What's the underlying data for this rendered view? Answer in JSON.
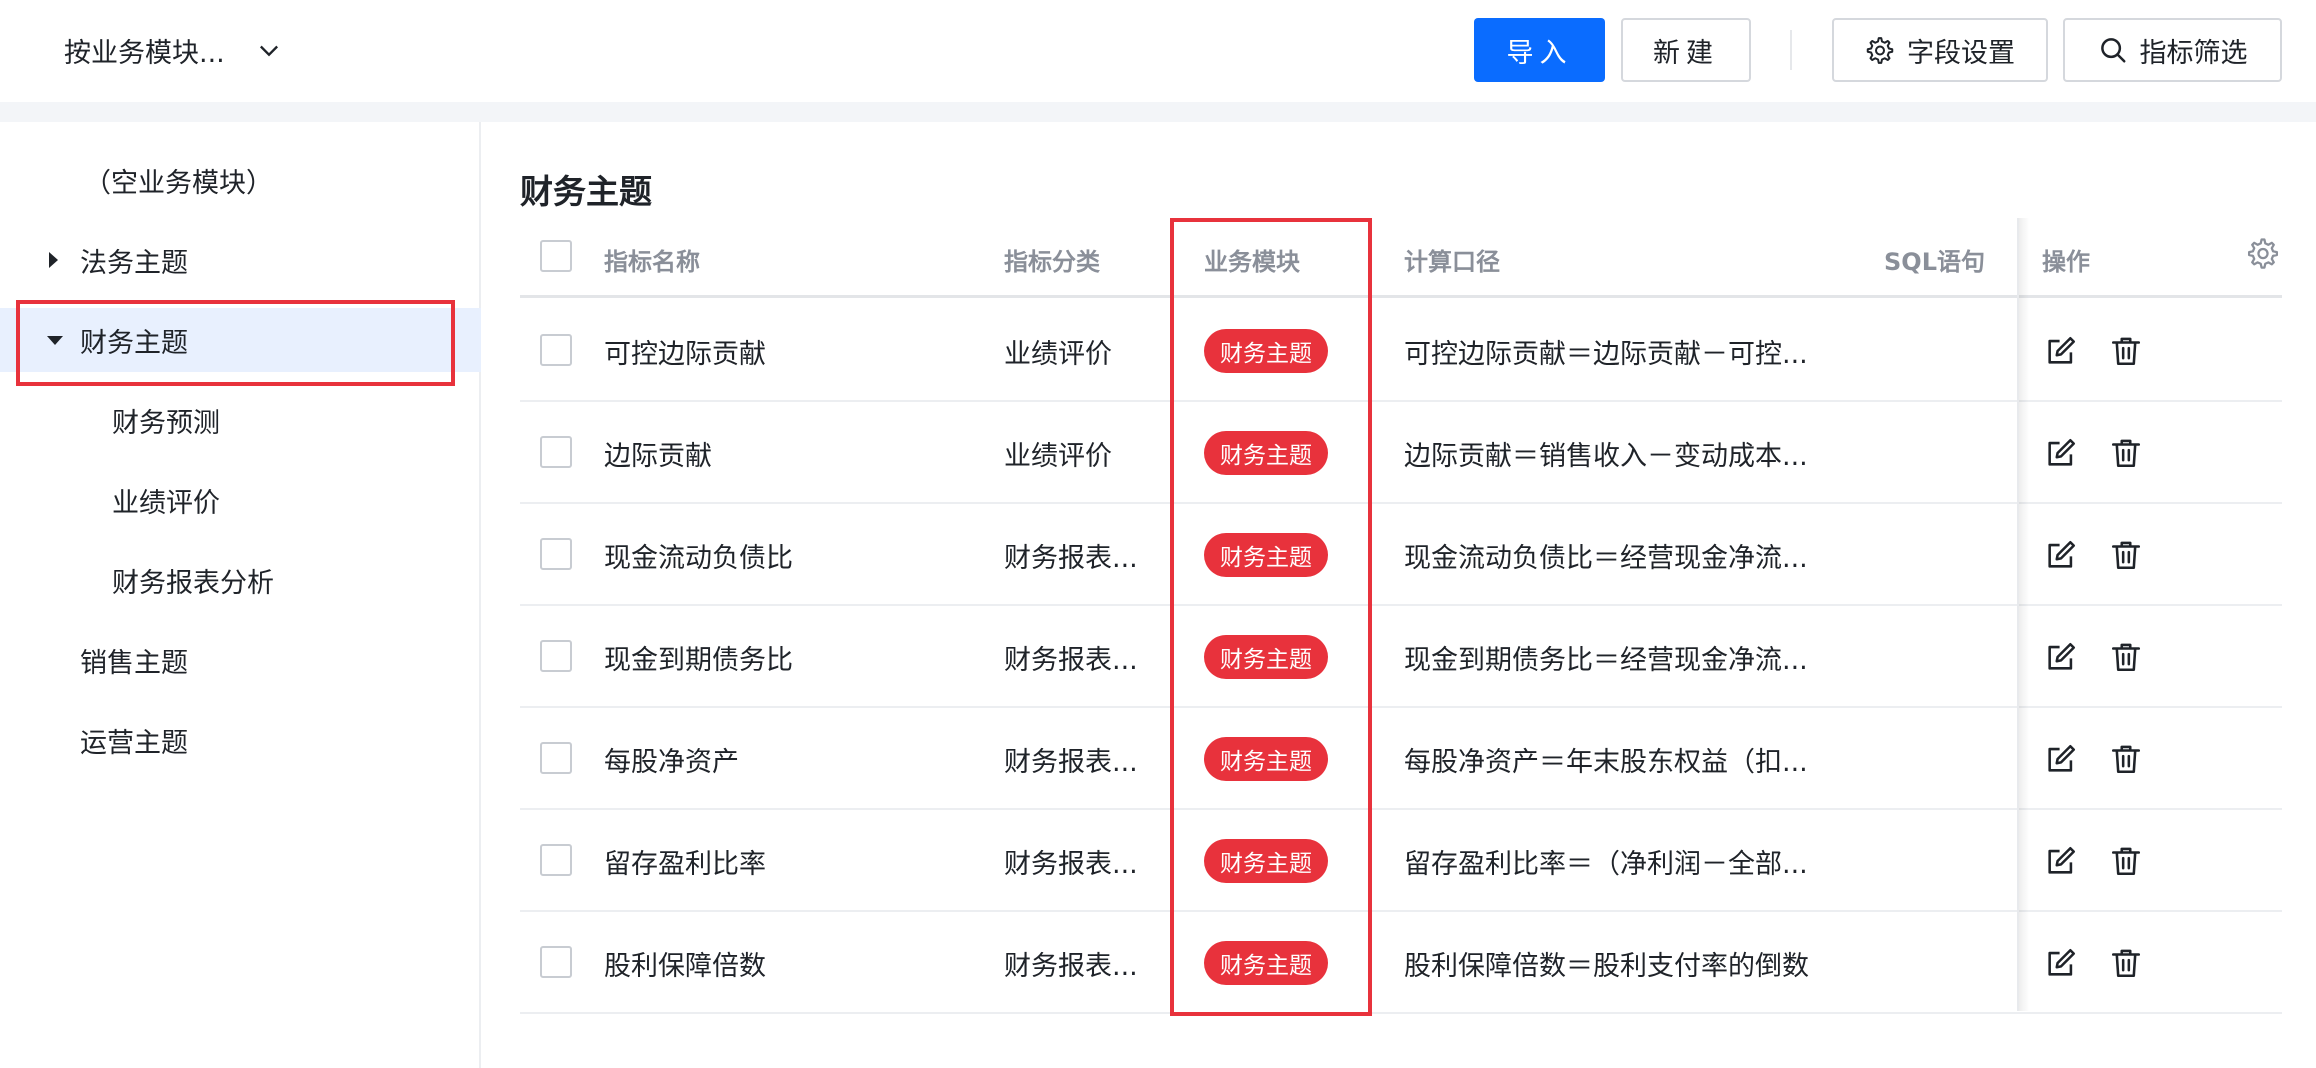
{
  "header": {
    "module_select": "按业务模块...",
    "import_label": "导入",
    "new_label": "新建",
    "field_settings_label": "字段设置",
    "filter_label": "指标筛选"
  },
  "sidebar": {
    "items": [
      {
        "label": "（空业务模块）"
      },
      {
        "label": "法务主题"
      },
      {
        "label": "财务主题"
      },
      {
        "label": "财务预测"
      },
      {
        "label": "业绩评价"
      },
      {
        "label": "财务报表分析"
      },
      {
        "label": "销售主题"
      },
      {
        "label": "运营主题"
      }
    ]
  },
  "main": {
    "title": "财务主题",
    "columns": [
      "指标名称",
      "指标分类",
      "业务模块",
      "计算口径",
      "SQL语句",
      "操作"
    ],
    "rows": [
      {
        "name": "可控边际贡献",
        "category": "业绩评价",
        "module": "财务主题",
        "formula": "可控边际贡献＝边际贡献－可控..."
      },
      {
        "name": "边际贡献",
        "category": "业绩评价",
        "module": "财务主题",
        "formula": "边际贡献＝销售收入－变动成本..."
      },
      {
        "name": "现金流动负债比",
        "category": "财务报表...",
        "module": "财务主题",
        "formula": "现金流动负债比＝经营现金净流..."
      },
      {
        "name": "现金到期债务比",
        "category": "财务报表...",
        "module": "财务主题",
        "formula": "现金到期债务比＝经营现金净流..."
      },
      {
        "name": "每股净资产",
        "category": "财务报表...",
        "module": "财务主题",
        "formula": "每股净资产＝年末股东权益（扣..."
      },
      {
        "name": "留存盈利比率",
        "category": "财务报表...",
        "module": "财务主题",
        "formula": "留存盈利比率＝（净利润－全部..."
      },
      {
        "name": "股利保障倍数",
        "category": "财务报表...",
        "module": "财务主题",
        "formula": "股利保障倍数＝股利支付率的倒数"
      }
    ]
  },
  "colors": {
    "primary": "#0a6cff",
    "tag": "#e8323c",
    "highlight_border": "#e8323c",
    "selected_bg": "#e8f0fe"
  }
}
